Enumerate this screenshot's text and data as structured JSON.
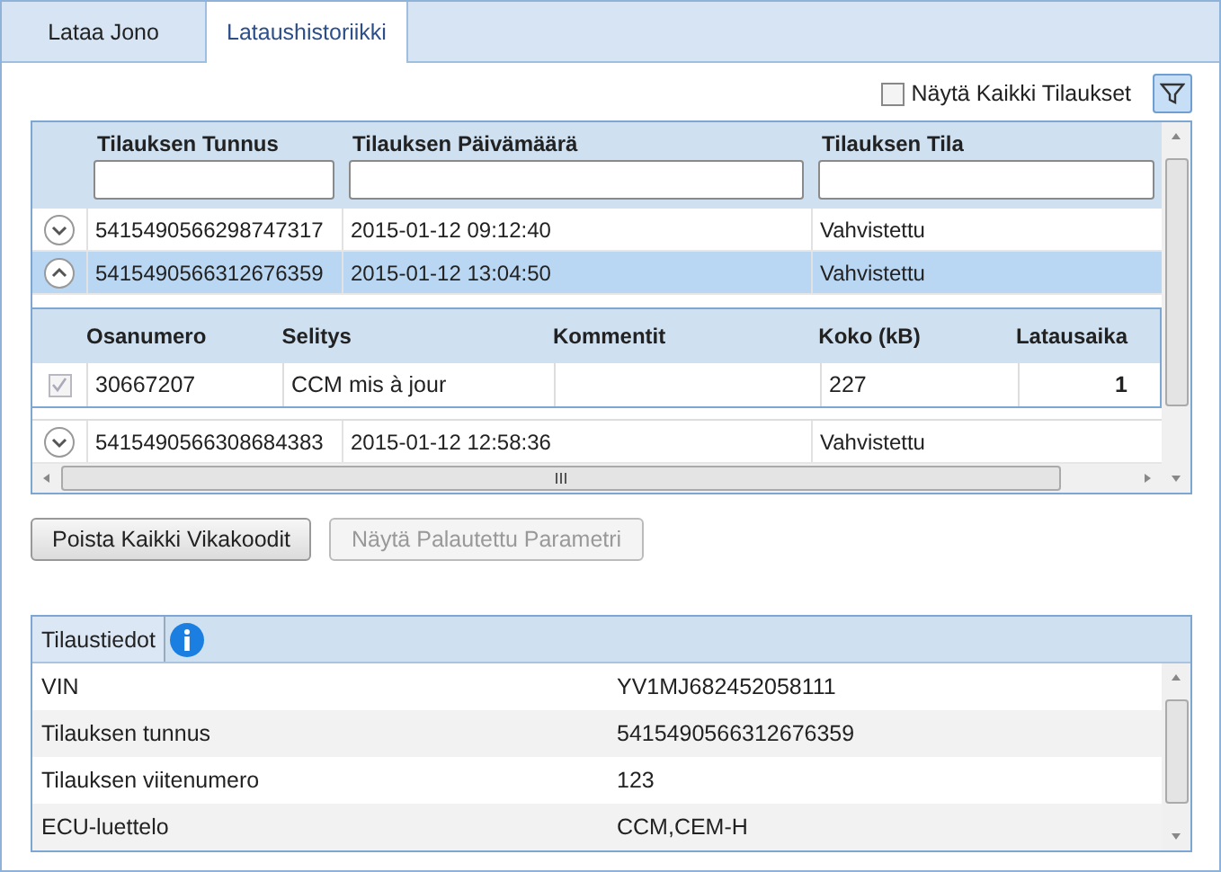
{
  "tabs": [
    {
      "label": "Lataa Jono",
      "selected": false
    },
    {
      "label": "Lataushistoriikki",
      "selected": true
    }
  ],
  "show_all": {
    "label": "Näytä Kaikki Tilaukset",
    "checked": false
  },
  "orders": {
    "columns": [
      "Tilauksen Tunnus",
      "Tilauksen Päivämäärä",
      "Tilauksen Tila"
    ],
    "rows": [
      {
        "id": "5415490566298747317",
        "date": "2015-01-12 09:12:40",
        "status": "Vahvistettu",
        "expanded": false,
        "selected": false
      },
      {
        "id": "5415490566312676359",
        "date": "2015-01-12 13:04:50",
        "status": "Vahvistettu",
        "expanded": true,
        "selected": true,
        "details": {
          "columns": [
            "Osanumero",
            "Selitys",
            "Kommentit",
            "Koko (kB)",
            "Latausaika"
          ],
          "rows": [
            {
              "checked": true,
              "cells": [
                "30667207",
                "CCM mis à jour",
                "",
                "227",
                "1"
              ]
            }
          ]
        }
      },
      {
        "id": "5415490566308684383",
        "date": "2015-01-12 12:58:36",
        "status": "Vahvistettu",
        "expanded": false,
        "selected": false
      }
    ]
  },
  "buttons": [
    {
      "label": "Poista Kaikki Vikakoodit",
      "disabled": false
    },
    {
      "label": "Näytä Palautettu Parametri",
      "disabled": true
    }
  ],
  "info": {
    "title": "Tilaustiedot",
    "rows": [
      {
        "label": "VIN",
        "value": "YV1MJ682452058111"
      },
      {
        "label": "Tilauksen tunnus",
        "value": "5415490566312676359"
      },
      {
        "label": "Tilauksen viitenumero",
        "value": "123"
      },
      {
        "label": "ECU-luettelo",
        "value": "CCM,CEM-H"
      }
    ]
  }
}
